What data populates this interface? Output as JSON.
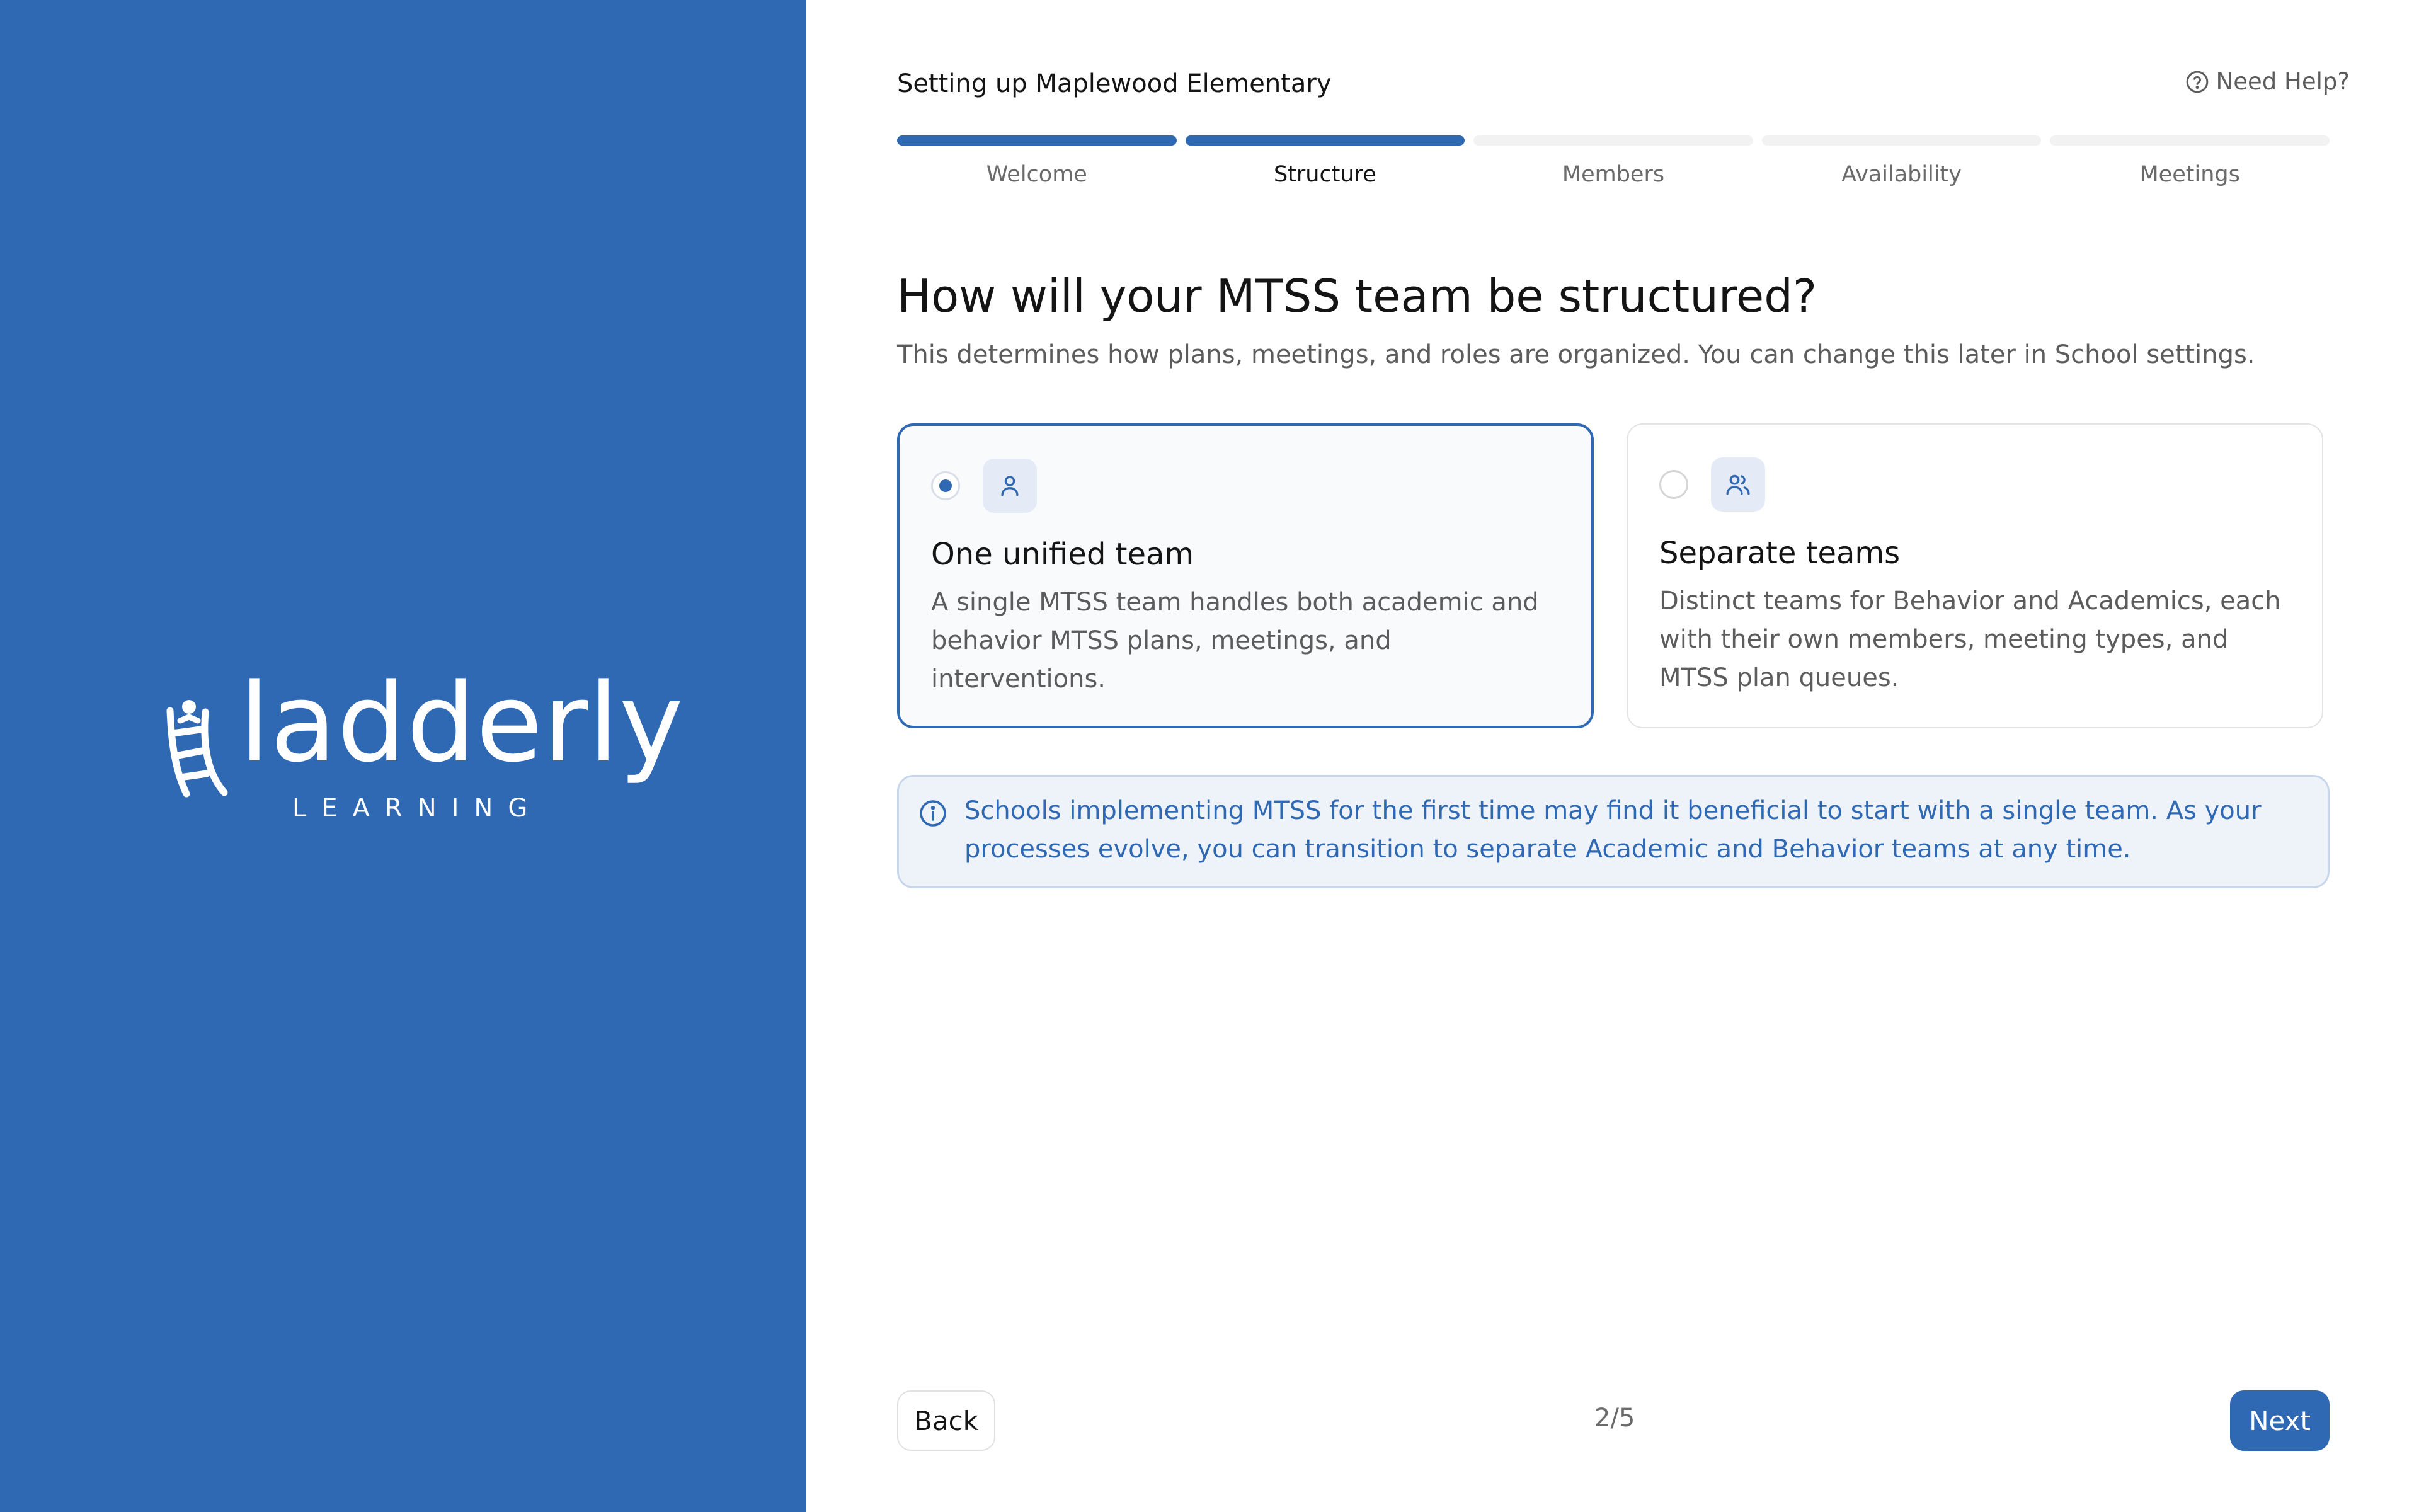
{
  "brand": {
    "name": "ladderly",
    "tagline": "LEARNING",
    "color": "#2f69b3"
  },
  "header": {
    "title": "Setting up Maplewood Elementary",
    "help_label": "Need Help?",
    "help_icon": "question-circle-icon"
  },
  "steps": [
    {
      "label": "Welcome",
      "status": "complete"
    },
    {
      "label": "Structure",
      "status": "current"
    },
    {
      "label": "Members",
      "status": "upcoming"
    },
    {
      "label": "Availability",
      "status": "upcoming"
    },
    {
      "label": "Meetings",
      "status": "upcoming"
    }
  ],
  "question": {
    "title": "How will your MTSS team be structured?",
    "subtitle": "This determines how plans, meetings, and roles are organized. You can change this later in School settings."
  },
  "options": [
    {
      "title": "One unified team",
      "description": "A single MTSS team handles both academic and behavior MTSS plans, meetings, and interventions.",
      "icon": "user-icon",
      "selected": true
    },
    {
      "title": "Separate teams",
      "description": "Distinct teams for Behavior and Academics, each with their own members, meeting types, and MTSS plan queues.",
      "icon": "users-icon",
      "selected": false
    }
  ],
  "info": {
    "icon": "info-icon",
    "text": "Schools implementing MTSS for the first time may find it beneficial to start with a single team. As your processes evolve, you can transition to separate Academic and Behavior teams at any time."
  },
  "footer": {
    "back_label": "Back",
    "page_indicator": "2/5",
    "next_label": "Next"
  }
}
